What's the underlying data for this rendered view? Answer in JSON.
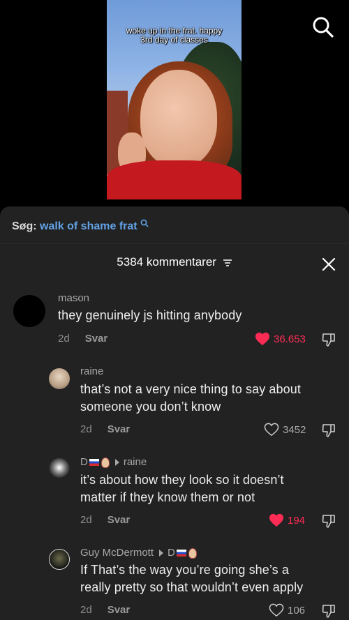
{
  "video": {
    "caption_line1": "woke up in the frat. happy",
    "caption_line2": "3rd day of classes"
  },
  "search_bar": {
    "prefix": "Søg:",
    "query": "walk of shame frat"
  },
  "comments_header": {
    "count_label": "5384 kommentarer"
  },
  "comments": [
    {
      "author": "mason",
      "text": "they genuinely js hitting anybody",
      "age": "2d",
      "reply_label": "Svar",
      "likes": "36.653",
      "liked": true
    },
    {
      "author": "raine",
      "text_line1": "that’s not a very nice thing to say about",
      "text_line2": "someone you don’t know",
      "age": "2d",
      "reply_label": "Svar",
      "likes": "3452",
      "liked": false
    },
    {
      "author": "D",
      "reply_to": "raine",
      "text_line1": "it’s about how they look so it doesn’t",
      "text_line2": "matter if they know them or not",
      "age": "2d",
      "reply_label": "Svar",
      "likes": "194",
      "liked": true
    },
    {
      "author": "Guy McDermott",
      "reply_to": "D",
      "text_line1": "If That’s the way you’re going she’s a",
      "text_line2": "really pretty so that wouldn’t even apply",
      "age": "2d",
      "reply_label": "Svar",
      "likes": "106",
      "liked": false
    }
  ],
  "colors": {
    "sheet_bg": "#222222",
    "accent_like": "#fe2c55",
    "search_link": "#62a2e6"
  }
}
